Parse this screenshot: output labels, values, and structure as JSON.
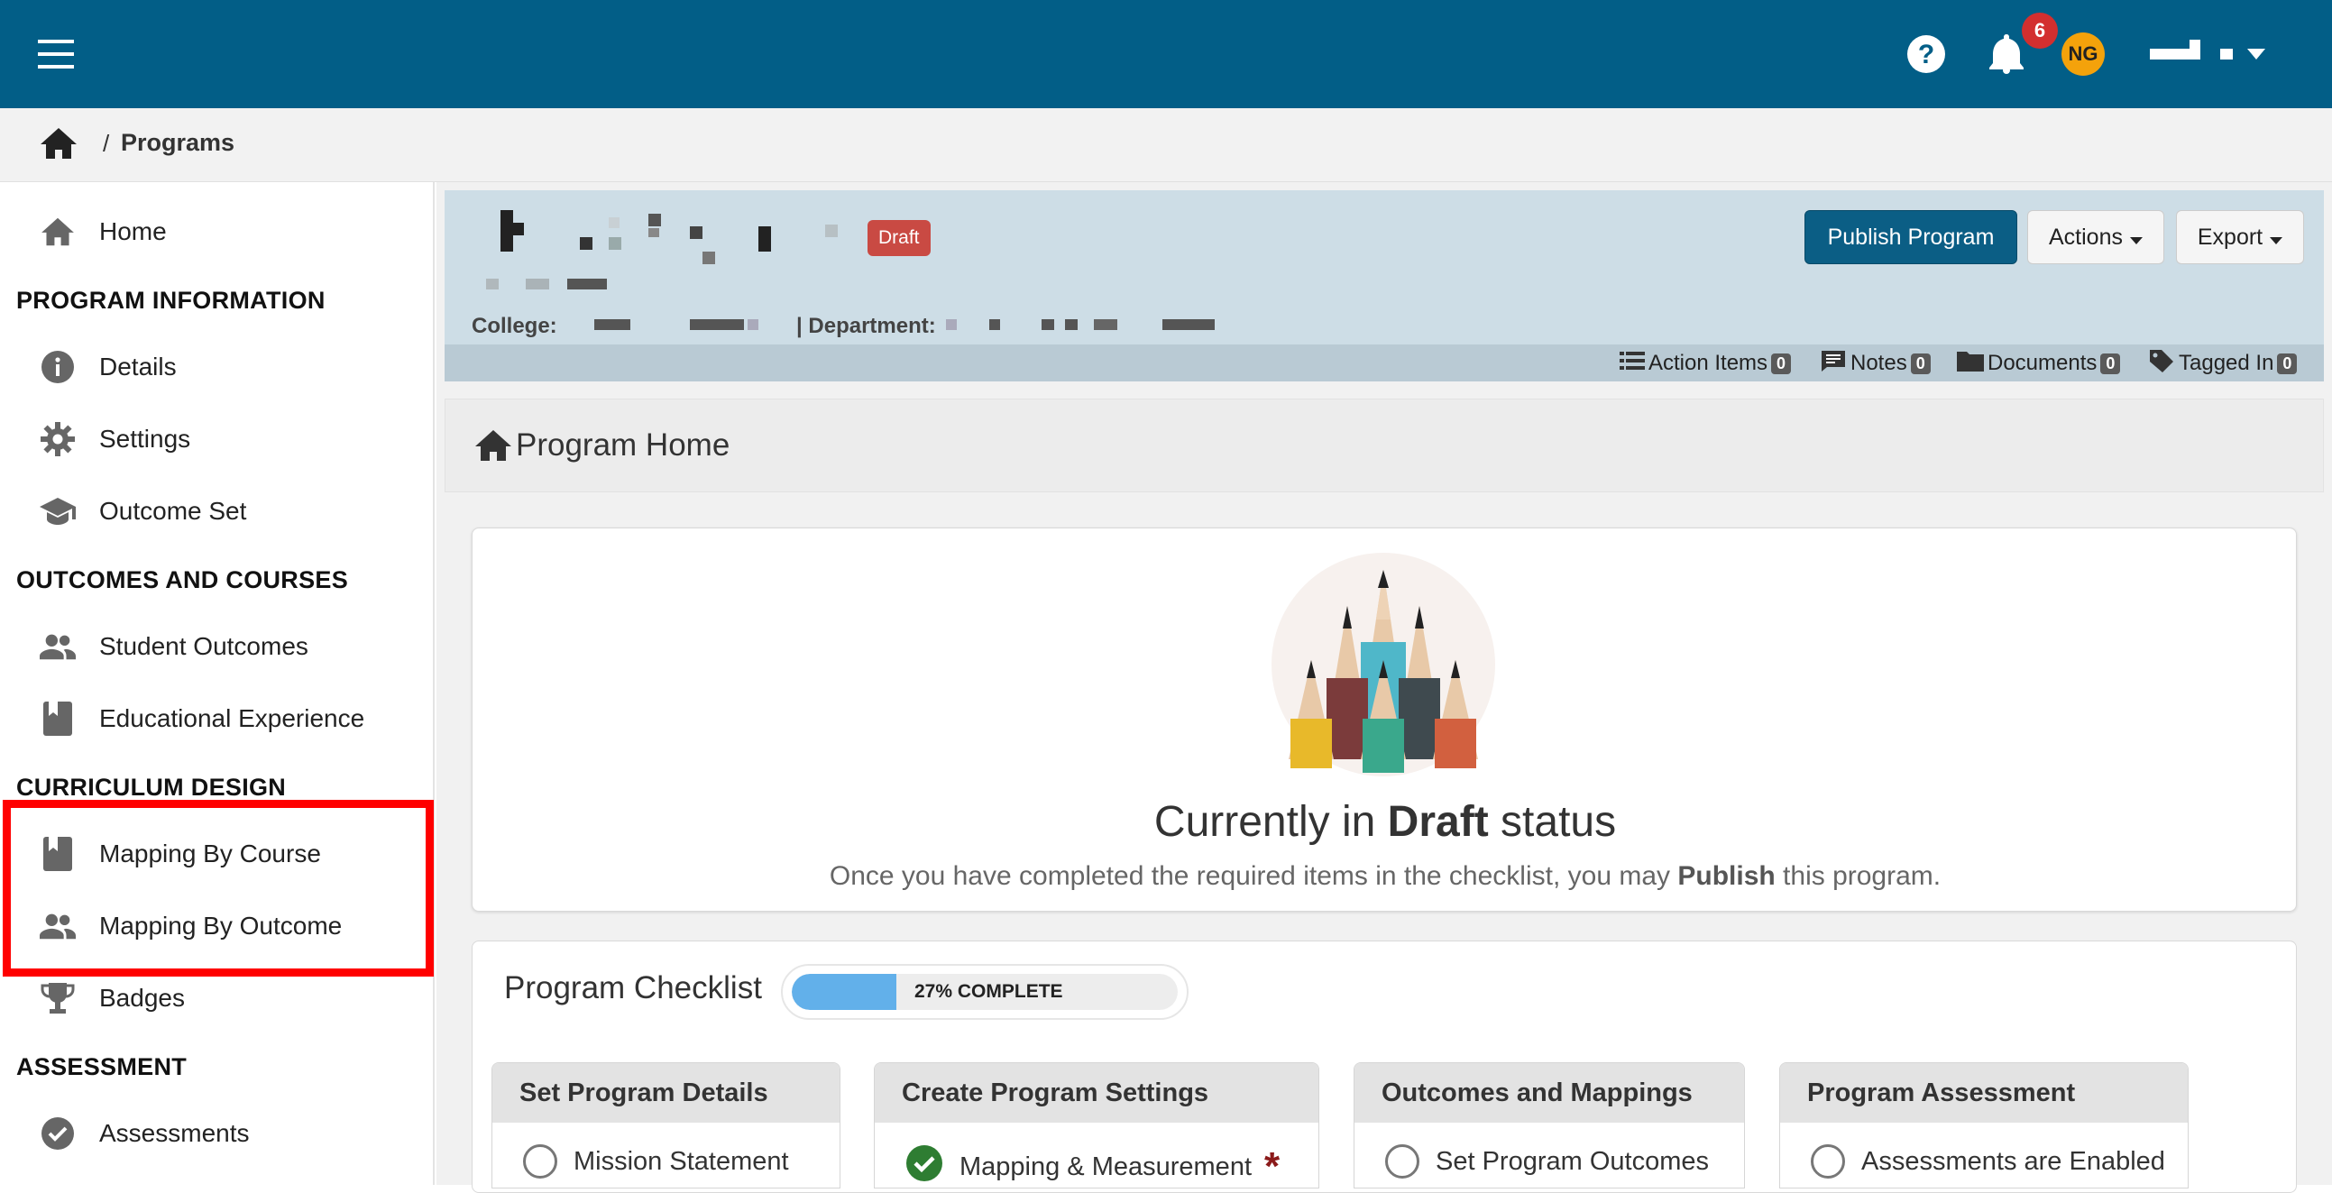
{
  "topbar": {
    "menu_icon": "hamburger-icon",
    "help_icon": "help-circle-icon",
    "bell_icon": "bell-icon",
    "notifications_count": "6",
    "avatar_initials": "NG",
    "colors": {
      "bar": "#025e87",
      "badge": "#d32f2f",
      "avatar": "#f4a20b"
    }
  },
  "breadcrumb": {
    "home_icon": "home-icon",
    "separator": "/",
    "current": "Programs"
  },
  "sidebar": {
    "home": "Home",
    "section_program_info": "PROGRAM INFORMATION",
    "details": "Details",
    "settings": "Settings",
    "outcome_set": "Outcome Set",
    "section_outcomes_courses": "OUTCOMES AND COURSES",
    "student_outcomes": "Student Outcomes",
    "educational_experience": "Educational Experience",
    "section_curriculum_design": "CURRICULUM DESIGN",
    "mapping_by_course": "Mapping By Course",
    "mapping_by_outcome": "Mapping By Outcome",
    "badges": "Badges",
    "section_assessment": "ASSESSMENT",
    "assessments": "Assessments"
  },
  "program_header": {
    "status_badge": "Draft",
    "college_label": "College:",
    "department_label": "| Department:",
    "publish_button": "Publish Program",
    "actions_button": "Actions",
    "export_button": "Export",
    "meta": {
      "action_items": "Action Items",
      "action_items_count": "0",
      "notes": "Notes",
      "notes_count": "0",
      "documents": "Documents",
      "documents_count": "0",
      "tagged_in": "Tagged In",
      "tagged_in_count": "0"
    }
  },
  "page_title": "Program Home",
  "status_card": {
    "headline_prefix": "Currently in",
    "headline_status": "Draft",
    "headline_suffix": "status",
    "sub_prefix": "Once you have completed the required items in the checklist, you may",
    "sub_bold": "Publish",
    "sub_suffix": "this program."
  },
  "checklist": {
    "title": "Program Checklist",
    "progress_label": "27% COMPLETE",
    "progress_fraction": 0.27,
    "columns": [
      {
        "title": "Set Program Details",
        "first_item": "Mission Statement",
        "done": false
      },
      {
        "title": "Create Program Settings",
        "first_item": "Mapping & Measurement",
        "done": true,
        "required_mark": "*"
      },
      {
        "title": "Outcomes and Mappings",
        "first_item": "Set Program Outcomes",
        "done": false
      },
      {
        "title": "Program Assessment",
        "first_item": "Assessments are Enabled",
        "done": false
      }
    ]
  }
}
